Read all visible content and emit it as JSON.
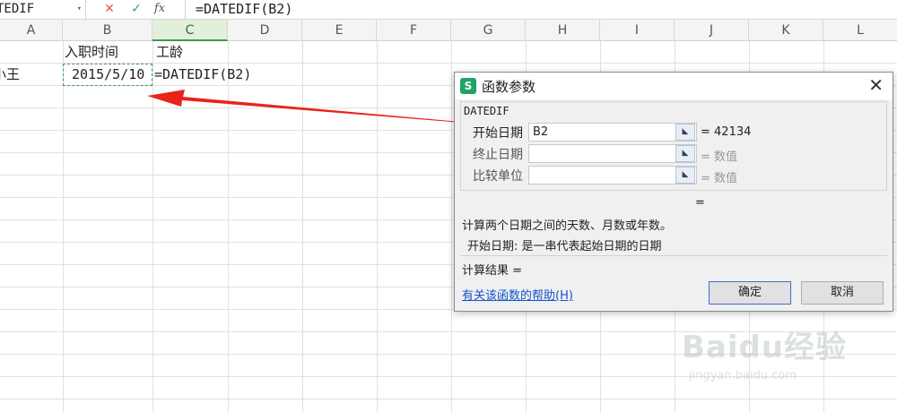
{
  "formula_bar": {
    "name_box": "TEDIF",
    "dropdown_icon": "▾",
    "cancel_icon": "✕",
    "enter_icon": "✓",
    "fx_label": "fx",
    "formula": "=DATEDIF(B2)"
  },
  "columns": [
    "A",
    "B",
    "C",
    "D",
    "E",
    "F",
    "G",
    "H",
    "I",
    "J",
    "K",
    "L"
  ],
  "active_column": "C",
  "cells": {
    "B1": "入职时间",
    "C1": "工龄",
    "A2": "小王",
    "B2": "2015/5/10",
    "C2": "=DATEDIF(B2)"
  },
  "dialog": {
    "title": "函数参数",
    "logo": "S",
    "close_icon": "✕",
    "function_name": "DATEDIF",
    "args": [
      {
        "label": "开始日期",
        "value": "B2",
        "result": "= 42134"
      },
      {
        "label": "终止日期",
        "value": "",
        "result": "= 数值"
      },
      {
        "label": "比较单位",
        "value": "",
        "result": "= 数值"
      }
    ],
    "equals": "=",
    "description": "计算两个日期之间的天数、月数或年数。",
    "arg_description": "开始日期: 是一串代表起始日期的日期",
    "result_label": "计算结果 =",
    "help_link": "有关该函数的帮助(H)",
    "ok_label": "确定",
    "cancel_label": "取消"
  },
  "colors": {
    "accent_green": "#3c9a52",
    "arrow_red": "#e8241a",
    "link_blue": "#1155cc"
  },
  "watermark": {
    "logo": "Baidu经验",
    "url": "jingyan.baidu.com"
  }
}
